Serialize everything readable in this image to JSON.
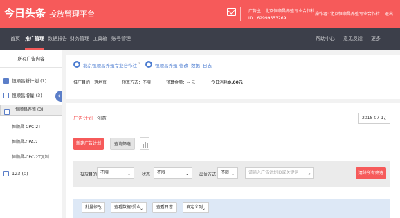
{
  "header": {
    "logo": "今日头条",
    "platform": "投放管理平台",
    "advertiser": "广告主：北京恒顺昌养殖专业合作社",
    "advertiser_id": "ID：62999553269",
    "operator": "操作者: 北京恒顺昌养殖专业合作社",
    "logout": "退出"
  },
  "nav": {
    "items": [
      "首页",
      "推广管理",
      "数据报告",
      "财务管理",
      "工具箱",
      "账号管理"
    ],
    "active": "推广管理",
    "right": [
      "帮助中心",
      "意见反馈",
      "更多"
    ]
  },
  "sidebar": {
    "title": "所有广告内容",
    "items": [
      {
        "label": "恒顺昌新计划 (1)"
      },
      {
        "label": "恒顺昌增量 (3)"
      },
      {
        "label": "恒顺昌养殖 (3)"
      }
    ],
    "subitems": [
      "恒顺昌-CPC-2T",
      "恒顺昌-CPA-2T",
      "恒顺昌-CPC-2T复制"
    ],
    "last": "123 (0)",
    "collapse_icon": "chevron-left-icon"
  },
  "breadcrumb": {
    "company": "北京恒顺昌养殖专业合作社",
    "campaign": "恒顺昌养殖",
    "actions": [
      "修改",
      "数据",
      "日志"
    ]
  },
  "stats": {
    "target": "推广目的：落地页",
    "budget_mode": "预算方式：不限",
    "budget": "预算金额：-- 元",
    "today_label": "今日消耗：",
    "today_value": "0.00元"
  },
  "tabs": [
    "广告计划",
    "创意"
  ],
  "date": "2018-07-17",
  "actions": {
    "new_plan": "新建广告计划",
    "query_filter": "查询筛选"
  },
  "filter": {
    "target_label": "投放目的",
    "target_value": "不限",
    "status_label": "状态",
    "status_value": "不限",
    "bid_label": "出价方式",
    "bid_value": "不限",
    "search_placeholder": "请输入广告计划ID或关键词",
    "clear": "清除所有筛选"
  },
  "batch": {
    "batch_edit": "批量修改",
    "view_data": "查看数据/受众",
    "view_log": "查看日志",
    "custom_cols": "自定义列"
  },
  "colors": {
    "accent": "#f65a5a",
    "nav_bg": "#3c3f4a",
    "link": "#4a7bd0"
  }
}
